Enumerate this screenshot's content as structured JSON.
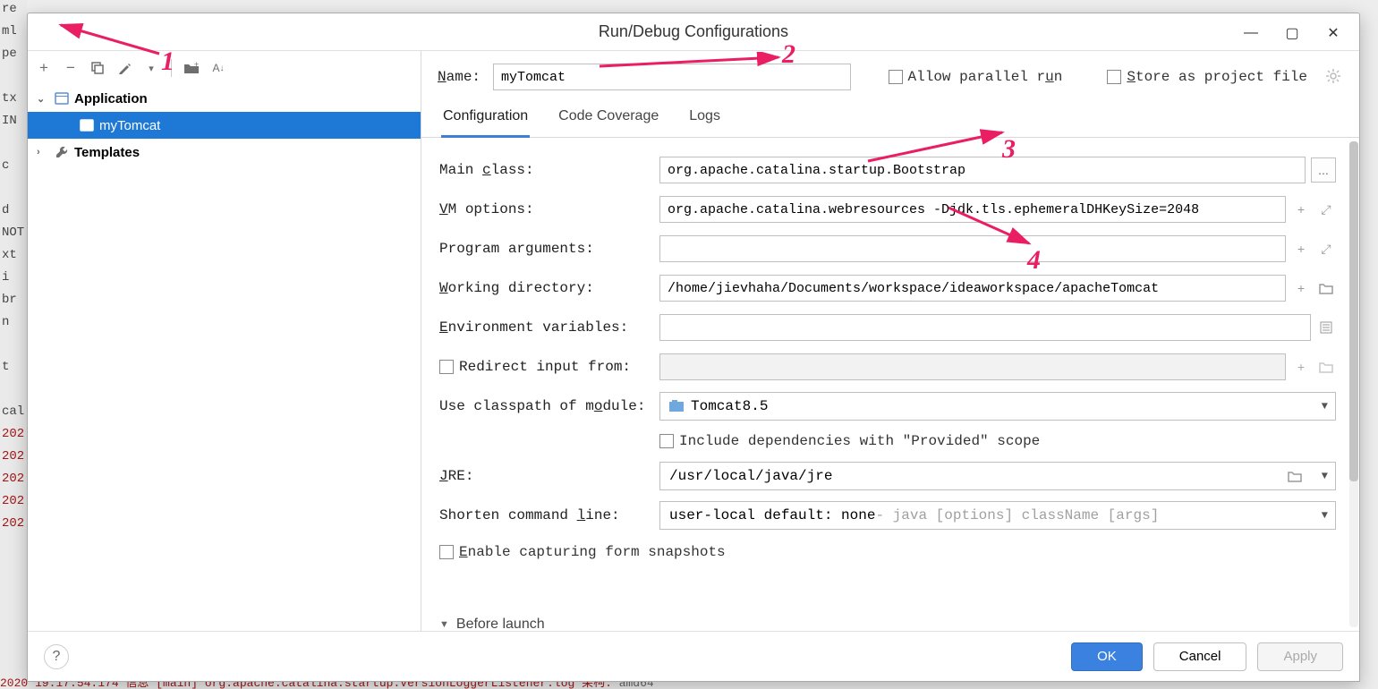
{
  "background": {
    "left_fragments": [
      "re",
      "ml",
      "pe",
      "",
      "tx",
      "IN",
      "",
      "c",
      "",
      "d",
      "NOT",
      "xt",
      "i",
      "br",
      "n",
      "",
      "t",
      "",
      "cal",
      "202",
      "202",
      "202",
      "202",
      "202"
    ],
    "bottom_pre": "2020 19:17:54.174 信息 [main] org.apache.catalina.startup.VersionLoggerListener.log 架构:",
    "bottom_tail": "            amd64"
  },
  "dialog": {
    "title": "Run/Debug Configurations",
    "win": {
      "minimize": "—",
      "maximize": "▢",
      "close": "✕"
    }
  },
  "toolbar": {
    "add": "+",
    "remove": "−",
    "copy": "⿻",
    "wrench": "🔧",
    "dropdown": "▾",
    "folder_add": "📁+",
    "sort": "ᴬ↓"
  },
  "tree": {
    "root1": {
      "exp": "⌄",
      "label": "Application"
    },
    "root1_items": [
      {
        "label": "myTomcat"
      }
    ],
    "root2": {
      "exp": "›",
      "label": "Templates"
    }
  },
  "name_row": {
    "label": "Name:",
    "value": "myTomcat",
    "allow_parallel": "Allow parallel run",
    "store_as_project": "Store as project file"
  },
  "tabs": [
    {
      "label": "Configuration",
      "active": true
    },
    {
      "label": "Code Coverage",
      "active": false
    },
    {
      "label": "Logs",
      "active": false
    }
  ],
  "form": {
    "main_class": {
      "label": "Main class:",
      "value": "org.apache.catalina.startup.Bootstrap"
    },
    "vm_options": {
      "label": "VM options:",
      "value": "org.apache.catalina.webresources -Djdk.tls.ephemeralDHKeySize=2048"
    },
    "program_args": {
      "label": "Program arguments:",
      "value": ""
    },
    "working_dir": {
      "label": "Working directory:",
      "value": "/home/jievhaha/Documents/workspace/ideaworkspace/apacheTomcat"
    },
    "env_vars": {
      "label": "Environment variables:",
      "value": ""
    },
    "redirect_input": {
      "label": "Redirect input from:",
      "value": ""
    },
    "classpath_module": {
      "label": "Use classpath of module:",
      "value": "Tomcat8.5"
    },
    "include_provided": "Include dependencies with \"Provided\" scope",
    "jre": {
      "label": "JRE:",
      "value": "/usr/local/java/jre"
    },
    "shorten": {
      "label": "Shorten command line:",
      "value": "user-local default: none",
      "hint": " - java [options] className [args]"
    },
    "enable_form_snap": "Enable capturing form snapshots",
    "before_launch": "Before launch"
  },
  "footer": {
    "ok": "OK",
    "cancel": "Cancel",
    "apply": "Apply"
  },
  "annotations": {
    "n1": "1",
    "n2": "2",
    "n3": "3",
    "n4": "4"
  }
}
